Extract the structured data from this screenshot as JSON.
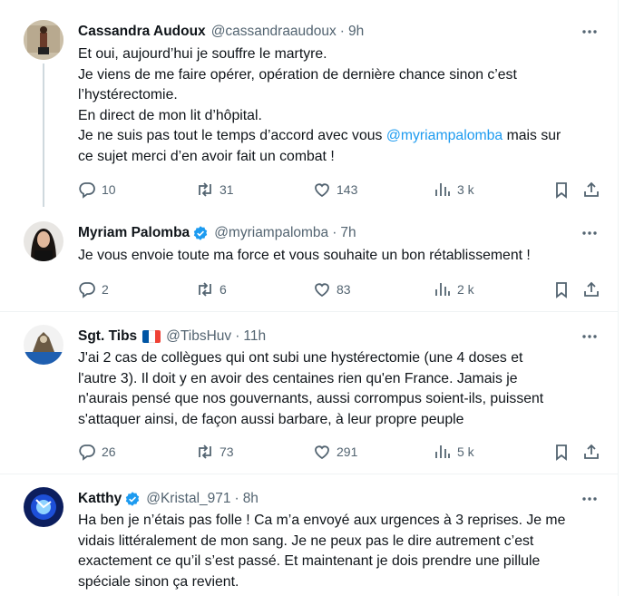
{
  "tweets": [
    {
      "name": "Cassandra Audoux",
      "handle": "@cassandraaudoux",
      "time": "9h",
      "lines": [
        "Et oui, aujourd’hui je souffre le martyre.",
        "Je viens de me faire opérer, opération de dernière chance sinon c’est",
        "l’hystérectomie.",
        "En direct de mon lit d’hôpital."
      ],
      "line5_pre": "Je ne suis pas tout le temps d’accord avec vous ",
      "line5_mention": "@myriampalomba",
      "line5_post": " mais sur",
      "line6": "ce sujet merci d’en avoir fait un combat !",
      "replies": "10",
      "retweets": "31",
      "likes": "143",
      "views": "3 k"
    },
    {
      "name": "Myriam Palomba",
      "handle": "@myriampalomba",
      "time": "7h",
      "verified": true,
      "text": "Je vous envoie toute ma force et vous souhaite un bon rétablissement !",
      "replies": "2",
      "retweets": "6",
      "likes": "83",
      "views": "2 k"
    },
    {
      "name": "Sgt. Tibs",
      "flag_colors": [
        "#0055a4",
        "#ffffff",
        "#ef4135"
      ],
      "handle": "@TibsHuv",
      "time": "11h",
      "lines": [
        "J'ai 2 cas de collègues qui ont subi une hystérectomie (une 4 doses et",
        "l'autre 3). Il doit y en avoir des centaines rien qu'en France. Jamais je",
        "n'aurais pensé que nos gouvernants, aussi corrompus soient-ils, puissent",
        "s'attaquer ainsi, de façon aussi barbare, à leur propre peuple"
      ],
      "replies": "26",
      "retweets": "73",
      "likes": "291",
      "views": "5 k"
    },
    {
      "name": "Katthy",
      "handle": "@Kristal_971",
      "time": "8h",
      "verified": true,
      "lines": [
        "Ha ben je n’étais pas folle !  Ca m’a envoyé aux urgences à 3 reprises. Je me",
        "vidais littéralement de mon sang. Je ne peux pas le dire autrement c’est",
        "exactement ce qu’il s’est passé. Et maintenant je dois prendre une pillule",
        "spéciale sinon ça revient."
      ]
    }
  ],
  "separator": "·",
  "colors": {
    "accent": "#1d9bf0",
    "muted": "#536471",
    "text": "#0f1419",
    "border": "#eff3f4"
  },
  "icons": [
    "reply-icon",
    "retweet-icon",
    "like-icon",
    "views-icon",
    "bookmark-icon",
    "share-icon",
    "more-icon",
    "verified-badge-icon"
  ]
}
